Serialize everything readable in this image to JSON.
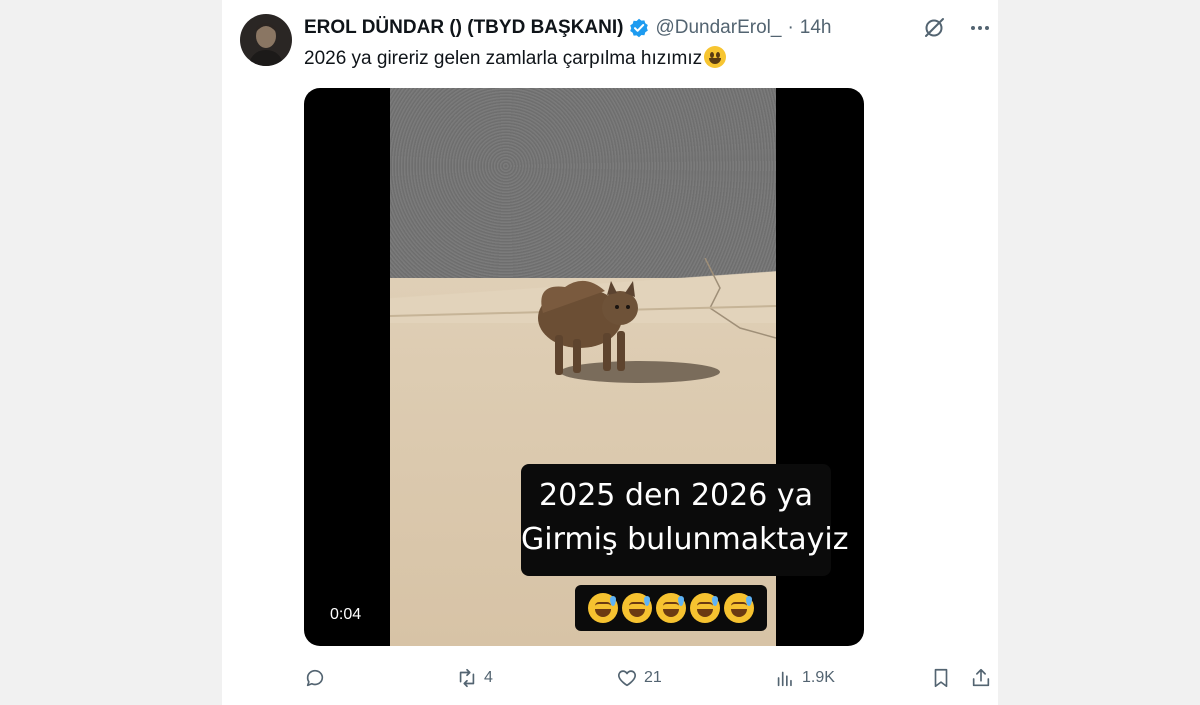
{
  "tweet": {
    "author_name": "EROL DÜNDAR () (TBYD BAŞKANI)",
    "handle": "@DundarErol_",
    "separator": "·",
    "time": "14h",
    "text": "2026 ya gireriz gelen zamlarla çarpılma hızımız",
    "text_emoji": "grinning-face-emoji"
  },
  "media": {
    "duration": "0:04",
    "caption_line1": "2025 den 2026 ya",
    "caption_line2": "Girmiş bulunmaktayiz",
    "caption_emojis": [
      "sweat-smile",
      "sweat-smile",
      "sweat-smile",
      "sweat-smile",
      "sweat-smile"
    ]
  },
  "actions": {
    "reply_count": "",
    "retweet_count": "4",
    "like_count": "21",
    "views_count": "1.9K"
  },
  "colors": {
    "verified": "#1d9bf0",
    "muted_text": "#536471",
    "background": "#f1f1f1"
  }
}
